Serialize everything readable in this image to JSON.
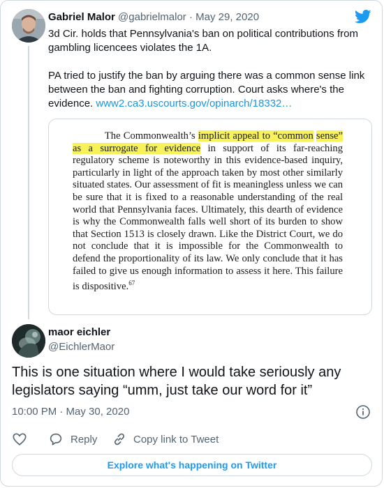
{
  "tweet1": {
    "author_name": "Gabriel Malor",
    "author_handle": "@gabrielmalor",
    "separator": "·",
    "date": "May 29, 2020",
    "text_p1": "3d Cir. holds that Pennsylvania's ban on political contributions from gambling licencees violates the 1A.",
    "text_p2": "PA tried to justify the ban by arguing there was a common sense link between the ban and fighting corruption. Court asks where's the evidence.",
    "link": "www2.ca3.uscourts.gov/opinarch/18332…"
  },
  "quoted_image": {
    "lead": "The Commonwealth’s ",
    "highlight_1": "implicit appeal to “common",
    "highlight_2": "sense” as a surrogate for evidence",
    "body": " in support of its far-reaching regulatory scheme is noteworthy in this evidence-based inquiry, particularly in light of the approach taken by most other similarly situated states.  Our assessment of fit is meaningless unless we can be sure that it is fixed to a reasonable understanding of the real world that Pennsylvania faces.  Ultimately, this dearth of evidence is why the Commonwealth falls well short of its burden to show that Section 1513 is closely drawn.  Like the District Court, we do not conclude that it is impossible for the Commonwealth to defend the proportionality of its law.  We only conclude that it has failed to give us enough information to assess it here.  This failure is dispositive.",
    "footnote": "67"
  },
  "tweet2": {
    "author_name": "maor eichler",
    "author_handle": "@EichlerMaor",
    "text": "This is one situation where I would take seriously any legislators saying “umm, just take our word for it”",
    "timestamp": "10:00 PM · May 30, 2020"
  },
  "actions": {
    "reply_label": "Reply",
    "copy_link_label": "Copy link to Tweet"
  },
  "explore_label": "Explore what's happening on Twitter",
  "icons": {
    "brand": "twitter-bird-icon",
    "like": "heart-icon",
    "reply": "speech-bubble-icon",
    "copy_link": "link-icon",
    "info": "info-icon"
  },
  "colors": {
    "link": "#1b95e0",
    "brand": "#1d9bf0",
    "highlight": "#f7f25a",
    "muted": "#536471"
  }
}
